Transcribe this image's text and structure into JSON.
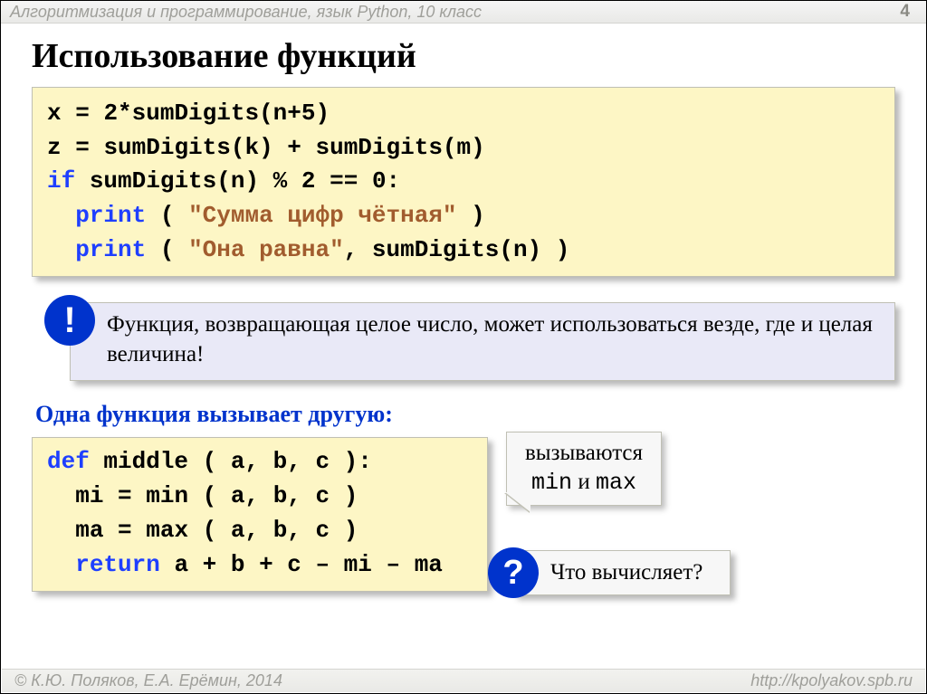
{
  "header": {
    "course": "Алгоритмизация и программирование, язык Python, 10 класс",
    "page": "4"
  },
  "title": "Использование функций",
  "code1": {
    "l1_a": "x",
    "l1_eq": "=",
    "l1_b": "2*sumDigits(n+5)",
    "l2_a": "z",
    "l2_eq": "=",
    "l2_b": "sumDigits(k)",
    "l2_plus": "+",
    "l2_c": "sumDigits(m)",
    "l3_if": "if",
    "l3_a": "sumDigits(n)",
    "l3_mod": "%",
    "l3_two": "2",
    "l3_eqeq": "==",
    "l3_zero": "0:",
    "l4_print": "print",
    "l4_open": "(",
    "l4_str": "\"Сумма цифр чётная\"",
    "l4_close": ")",
    "l5_print": "print",
    "l5_open": "(",
    "l5_str": "\"Она равна\"",
    "l5_comma": ",",
    "l5_call": "sumDigits(n)",
    "l5_close": ")"
  },
  "hint": "Функция, возвращающая целое число, может использоваться везде, где и целая величина!",
  "subhead": "Одна функция вызывает другую:",
  "code2": {
    "l1_def": "def",
    "l1_name": "middle",
    "l1_args": "( a, b, c ):",
    "l2": "mi",
    "l2_eq": "=",
    "l2_rest": "min ( a, b, c )",
    "l3": "ma",
    "l3_eq": "=",
    "l3_rest": "max ( a, b, c )",
    "l4_ret": "return",
    "l4_expr": "a + b + c – mi – ma"
  },
  "callout": {
    "line1": "вызываются",
    "min": "min",
    "and": " и ",
    "max": "max"
  },
  "question": "Что вычисляет?",
  "footer": {
    "left": "© К.Ю. Поляков, Е.А. Ерёмин, 2014",
    "right": "http://kpolyakov.spb.ru"
  },
  "glyphs": {
    "bang": "!",
    "q": "?"
  }
}
